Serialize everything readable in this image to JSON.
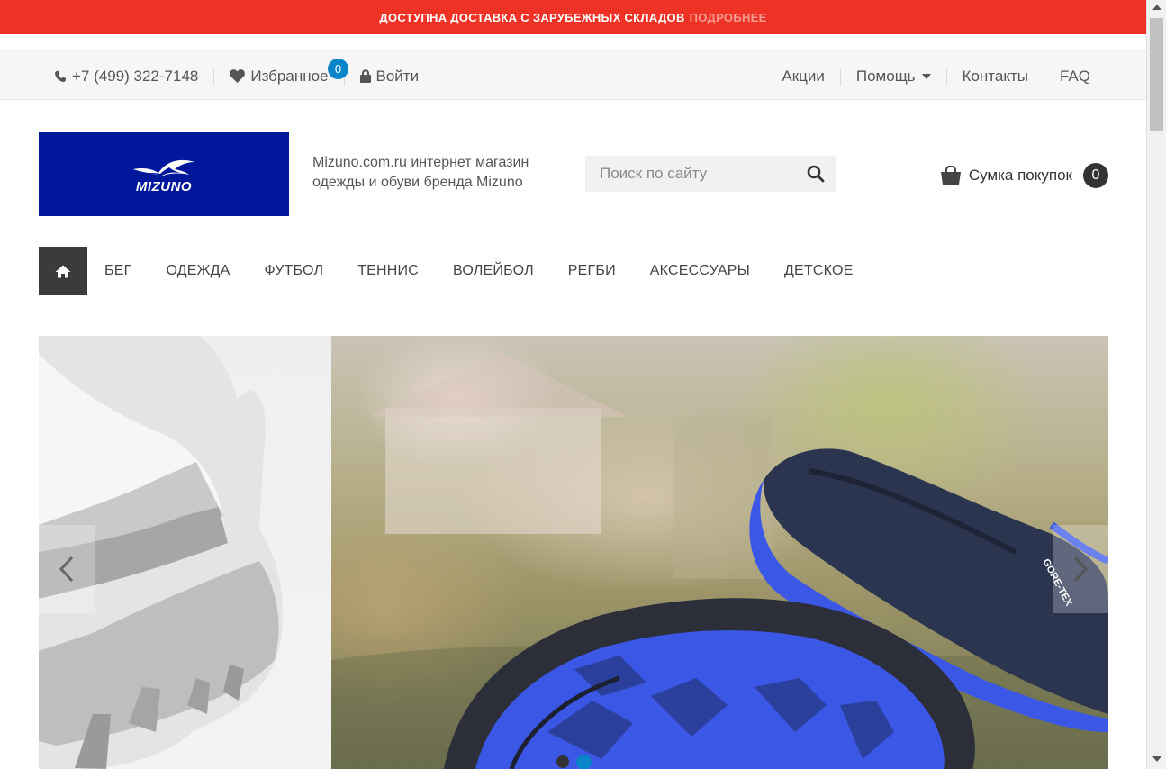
{
  "promo": {
    "text": "ДОСТУПНА ДОСТАВКА С ЗАРУБЕЖНЫХ СКЛАДОВ",
    "link": "ПОДРОБНЕЕ"
  },
  "topbar": {
    "phone": "+7 (499) 322-7148",
    "favorites_label": "Избранное",
    "favorites_count": "0",
    "login_label": "Войти",
    "links": {
      "promo": "Акции",
      "help": "Помощь",
      "contacts": "Контакты",
      "faq": "FAQ"
    }
  },
  "header": {
    "logo_alt": "MIZUNO",
    "tagline": "Mizuno.com.ru интернет магазин одежды и обуви бренда Mizuno",
    "search_placeholder": "Поиск по сайту",
    "cart_label": "Сумка покупок",
    "cart_count": "0"
  },
  "nav": {
    "items": [
      "БЕГ",
      "ОДЕЖДА",
      "ФУТБОЛ",
      "ТЕННИС",
      "ВОЛЕЙБОЛ",
      "РЕГБИ",
      "АКСЕССУАРЫ",
      "ДЕТСКОЕ"
    ]
  },
  "slider": {
    "slide_count": 2,
    "active_slide": 2,
    "shoe_label": "GORE-TEX"
  },
  "colors": {
    "promo": "#ef3226",
    "logo_bg": "#00169b",
    "badge": "#0a85c9",
    "home_bg": "#3b3b3b",
    "shoe_blue": "#3a57e6"
  },
  "icons": {
    "phone": "phone-icon",
    "favorites": "heart-icon",
    "login": "lock-icon",
    "search": "search-icon",
    "cart": "shopping-bag-icon",
    "home": "home-icon"
  }
}
